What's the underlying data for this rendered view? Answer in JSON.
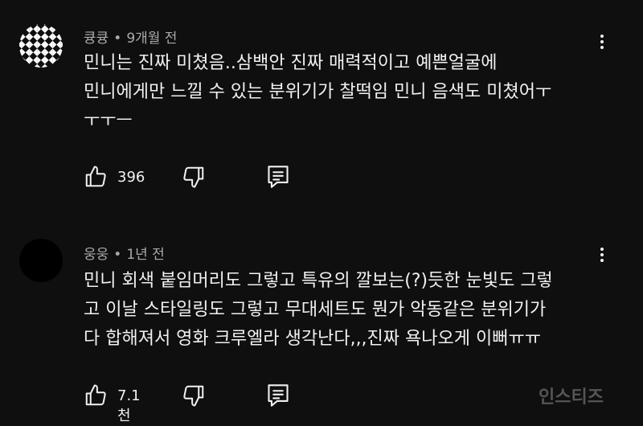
{
  "comments": [
    {
      "author": "큥큥",
      "time": "9개월 전",
      "text": "민니는 진짜 미쳤음..삼백안 진짜 매력적이고 예쁜얼굴에\n민니에게만 느낄 수 있는 분위기가 찰떡임 민니 음색도 미쳤어ㅜ\nㅜㅜㅡ",
      "likes": "396"
    },
    {
      "author": "웅웅",
      "time": "1년 전",
      "text": "민니 회색 붙임머리도 그렇고 특유의 깔보는(?)듯한 눈빛도 그렇\n고 이날 스타일링도 그렇고 무대세트도 뭔가 악동같은 분위기가\n다 합해져서 영화 크루엘라 생각난다,,,진짜 욕나오게 이뻐ㅠㅠ",
      "likes": "7.1천"
    }
  ],
  "separator": "•",
  "watermark": "인스티즈"
}
